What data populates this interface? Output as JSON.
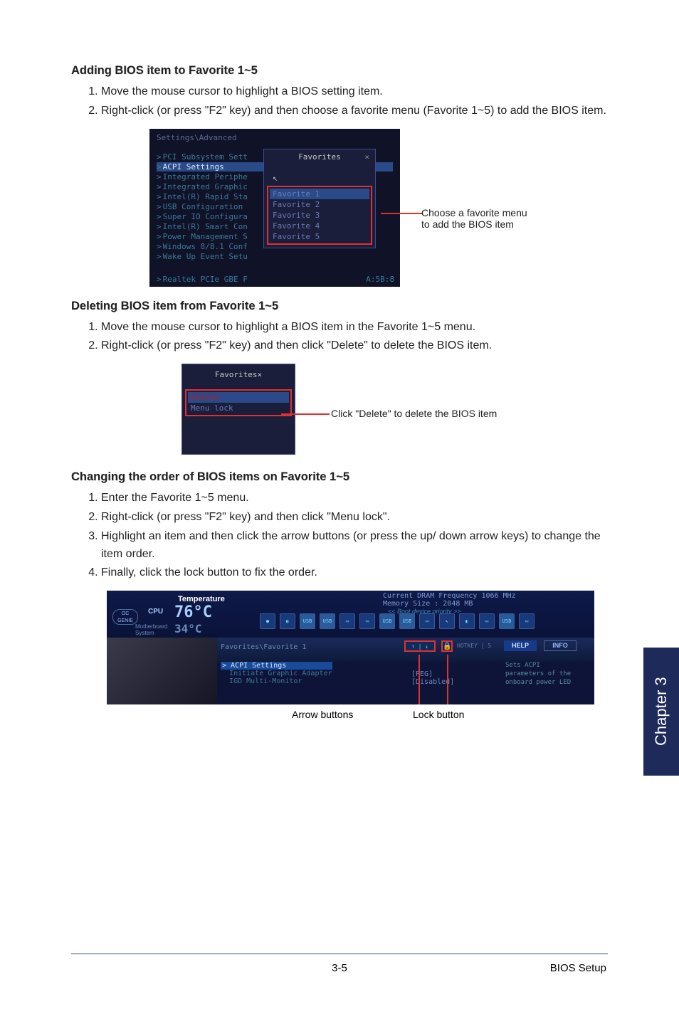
{
  "sections": {
    "add": {
      "title": "Adding BIOS item to Favorite 1~5",
      "steps": [
        "Move the mouse cursor to highlight a BIOS setting item.",
        "Right-click (or press \"F2\" key) and then choose a favorite menu (Favorite 1~5) to add the BIOS item."
      ],
      "bios_breadcrumb": "Settings\\Advanced",
      "bios_items": [
        "PCI Subsystem Sett",
        "ACPI Settings",
        "Integrated Periphe",
        "Integrated Graphic",
        "Intel(R) Rapid Sta",
        "USB Configuration",
        "Super IO Configura",
        "Intel(R) Smart Con",
        "Power Management S",
        "Windows 8/8.1 Conf",
        "Wake Up Event Setu"
      ],
      "bios_footer": "Realtek PCIe GBE F",
      "bios_footer_time": "A:5B:8",
      "popup_title": "Favorites",
      "popup_items": [
        "Favorite 1",
        "Favorite 2",
        "Favorite 3",
        "Favorite 4",
        "Favorite 5"
      ],
      "annotation": "Choose a favorite menu to add the BIOS item"
    },
    "del": {
      "title": "Deleting BIOS item from Favorite 1~5",
      "steps": [
        "Move the mouse cursor to highlight a BIOS item in the Favorite 1~5 menu.",
        "Right-click (or press \"F2\" key) and then click \"Delete\" to delete the BIOS item."
      ],
      "popup_title": "Favorites",
      "popup_items": [
        "Delete",
        "Menu lock"
      ],
      "annotation": "Click \"Delete\" to delete the BIOS item"
    },
    "order": {
      "title": "Changing the order of BIOS items on Favorite 1~5",
      "steps": [
        "Enter the Favorite 1~5 menu.",
        "Right-click (or press \"F2\" key) and then click \"Menu lock\".",
        "Highlight an item and then click the arrow buttons (or press the up/ down arrow keys) to change the item order.",
        "Finally, click the lock button to fix the order."
      ],
      "bios": {
        "temp_label": "Temperature",
        "cpu_label": "CPU",
        "mb_label": "Motherboard\nSystem",
        "cpu_temp": "76°C",
        "mb_temp": "34°C",
        "dram_line1": "Current DRAM Frequency 1066 MHz",
        "dram_line2": "Memory Size : 2048 MB",
        "boot_priority": "Boot device priority",
        "oc_genie": "OC\nGENIE",
        "fav_breadcrumb": "Favorites\\Favorite 1",
        "arrows": "↑ | ↓",
        "lock": "🔒",
        "hotkey": "HOTKEY | 5",
        "help_btn": "HELP",
        "info_btn": "INFO",
        "items": [
          "ACPI Settings",
          "Initiate Graphic Adapter",
          "IGD Multi-Monitor"
        ],
        "vals": [
          "[PEG]",
          "[Disabled]"
        ],
        "help_text": "Sets ACPI parameters of the onboard power LED behavior"
      },
      "cap_arrow": "Arrow buttons",
      "cap_lock": "Lock button"
    }
  },
  "side_tab": "Chapter 3",
  "footer": {
    "page": "3-5",
    "section": "BIOS Setup"
  }
}
